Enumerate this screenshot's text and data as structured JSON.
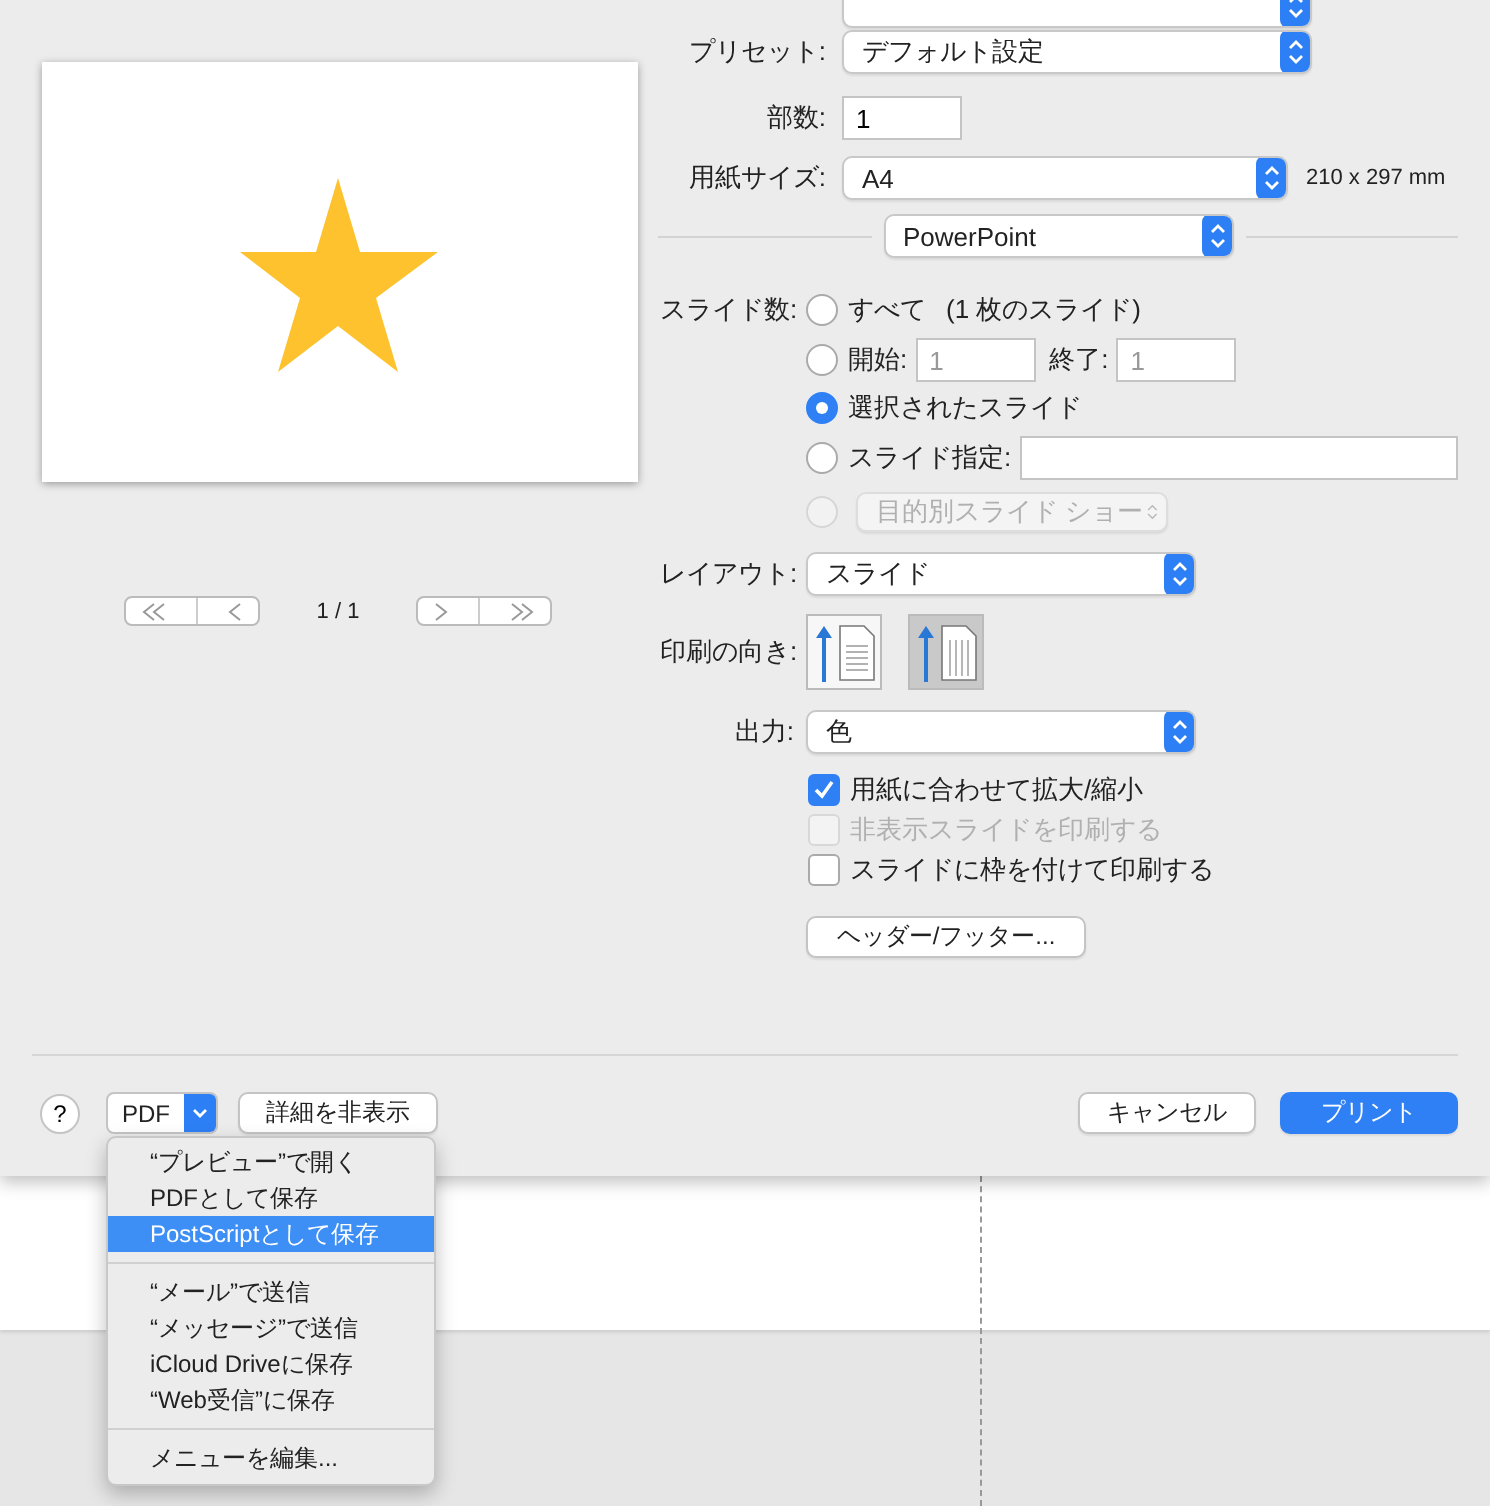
{
  "preview": {
    "page_indicator": "1 / 1"
  },
  "printer_settings": {
    "preset": {
      "label": "プリセット:",
      "value": "デフォルト設定"
    },
    "copies": {
      "label": "部数:",
      "value": "1"
    },
    "paper_size": {
      "label": "用紙サイズ:",
      "value": "A4",
      "dimensions": "210 x 297 mm"
    }
  },
  "app_popup": {
    "value": "PowerPoint"
  },
  "slides": {
    "label": "スライド数:",
    "options": [
      {
        "kind": "all",
        "label": "すべて",
        "note": "(1 枚のスライド)",
        "selected": false,
        "disabled": false
      },
      {
        "kind": "range",
        "label": "開始:",
        "from_placeholder": "1",
        "to_label": "終了:",
        "to_placeholder": "1",
        "selected": false,
        "disabled": false
      },
      {
        "kind": "plain",
        "label": "選択されたスライド",
        "selected": true,
        "disabled": false
      },
      {
        "kind": "field",
        "label": "スライド指定:",
        "selected": false,
        "disabled": false
      },
      {
        "kind": "popup",
        "value": "目的別スライド ショー",
        "selected": false,
        "disabled": true
      }
    ]
  },
  "layout": {
    "label": "レイアウト:",
    "value": "スライド"
  },
  "orientation": {
    "label": "印刷の向き:",
    "options": [
      {
        "kind": "portrait",
        "selected": false
      },
      {
        "kind": "landscape",
        "selected": true
      }
    ]
  },
  "output": {
    "label": "出力:",
    "value": "色"
  },
  "checkboxes": [
    {
      "label": "用紙に合わせて拡大/縮小",
      "checked": true,
      "disabled": false
    },
    {
      "label": "非表示スライドを印刷する",
      "checked": false,
      "disabled": true
    },
    {
      "label": "スライドに枠を付けて印刷する",
      "checked": false,
      "disabled": false
    }
  ],
  "header_footer_button": "ヘッダー/フッター...",
  "footer": {
    "help": "?",
    "pdf": "PDF",
    "details": "詳細を非表示",
    "cancel": "キャンセル",
    "print": "プリント"
  },
  "pdf_menu": {
    "groups": [
      [
        {
          "label": "“プレビュー”で開く",
          "selected": false
        },
        {
          "label": "PDFとして保存",
          "selected": false
        },
        {
          "label": "PostScriptとして保存",
          "selected": true
        }
      ],
      [
        {
          "label": "“メール”で送信",
          "selected": false
        },
        {
          "label": "“メッセージ”で送信",
          "selected": false
        },
        {
          "label": "iCloud Driveに保存",
          "selected": false
        },
        {
          "label": "“Web受信”に保存",
          "selected": false
        }
      ],
      [
        {
          "label": "メニューを編集...",
          "selected": false
        }
      ]
    ]
  }
}
